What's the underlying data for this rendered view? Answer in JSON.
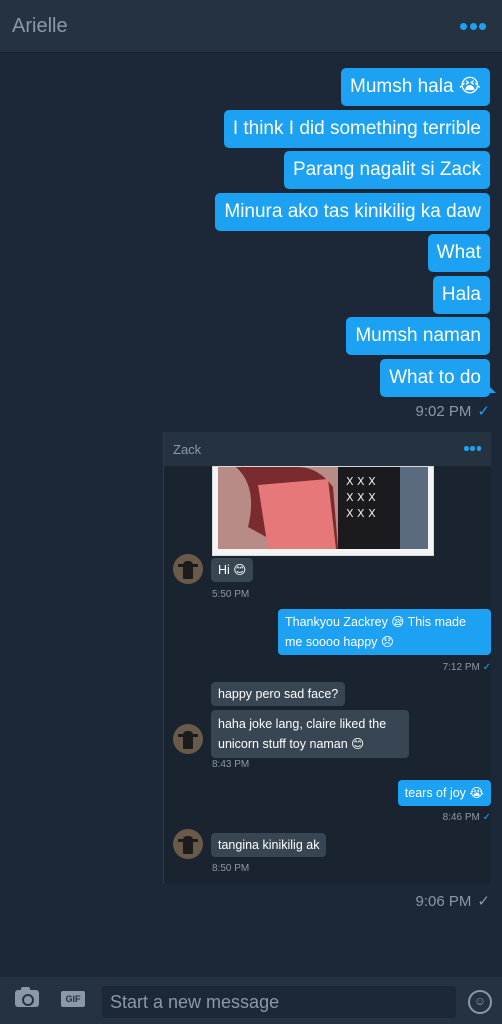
{
  "header": {
    "title": "Arielle"
  },
  "outgoing": [
    {
      "text": "Mumsh hala 😭"
    },
    {
      "text": "I think I did something terrible"
    },
    {
      "text": "Parang nagalit si Zack"
    },
    {
      "text": "Minura ako tas kinikilig ka daw"
    },
    {
      "text": "What"
    },
    {
      "text": "Hala"
    },
    {
      "text": "Mumsh naman"
    },
    {
      "text": "What to do"
    }
  ],
  "time1": "9:02 PM",
  "check": "✓",
  "screenshot": {
    "title": "Zack",
    "msg_hi": "Hi 😊",
    "t1": "5:50 PM",
    "out1_text": "Thankyou Zackrey 😪 This made me soooo happy 😞",
    "t2": "7:12 PM",
    "in2a": "happy pero sad face?",
    "in2b": "haha joke lang, claire liked the unicorn stuff toy naman 😊",
    "t3": "8:43 PM",
    "out2_text": "tears of joy 😭",
    "t4": "8:46 PM",
    "in3": "tangina kinikilig ak",
    "t5": "8:50 PM"
  },
  "time2": "9:06 PM",
  "composer": {
    "placeholder": "Start a new message",
    "gif_label": "GIF"
  }
}
